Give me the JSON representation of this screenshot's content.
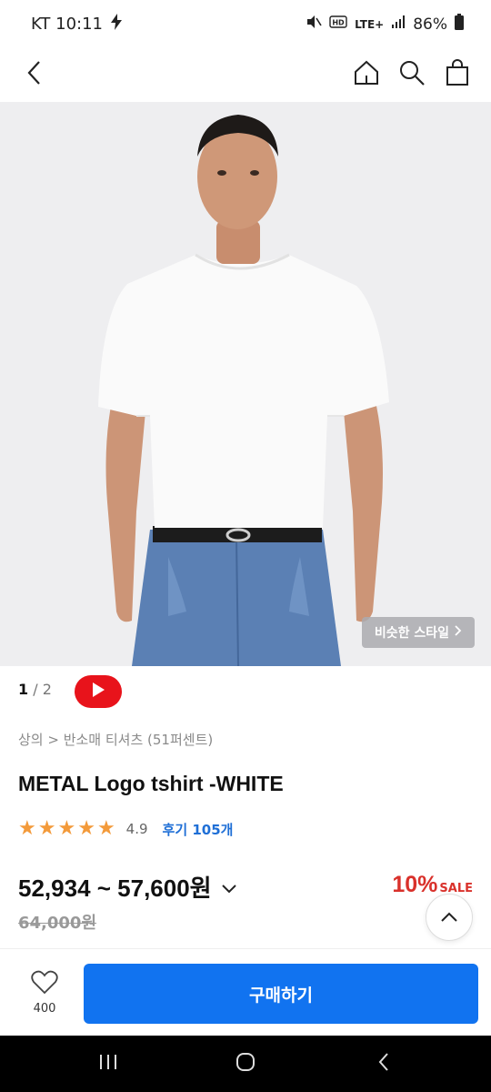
{
  "status_bar": {
    "carrier_time": "KT 10:11",
    "network": "LTE+",
    "battery": "86%"
  },
  "header": {
    "back_icon": "chevron-left-icon",
    "home_icon": "home-icon",
    "search_icon": "search-icon",
    "cart_icon": "shopping-bag-icon"
  },
  "gallery": {
    "current": "1",
    "separator": " / ",
    "total": "2",
    "similar_style_label": "비슷한 스타일"
  },
  "breadcrumb": "상의 > 반소매 티셔츠 (51퍼센트)",
  "product": {
    "title": "METAL Logo tshirt -WHITE",
    "rating_value": "4.9",
    "rating_stars": 5,
    "review_label": "후기 105개",
    "price_range": "52,934 ~ 57,600원",
    "original_price": "64,000원",
    "discount_percent": "10%",
    "discount_label": "SALE"
  },
  "actions": {
    "like_count": "400",
    "buy_label": "구매하기"
  },
  "colors": {
    "accent": "#1173f0",
    "sale": "#d9312b",
    "star": "#f39a3a",
    "youtube": "#e8131b"
  }
}
